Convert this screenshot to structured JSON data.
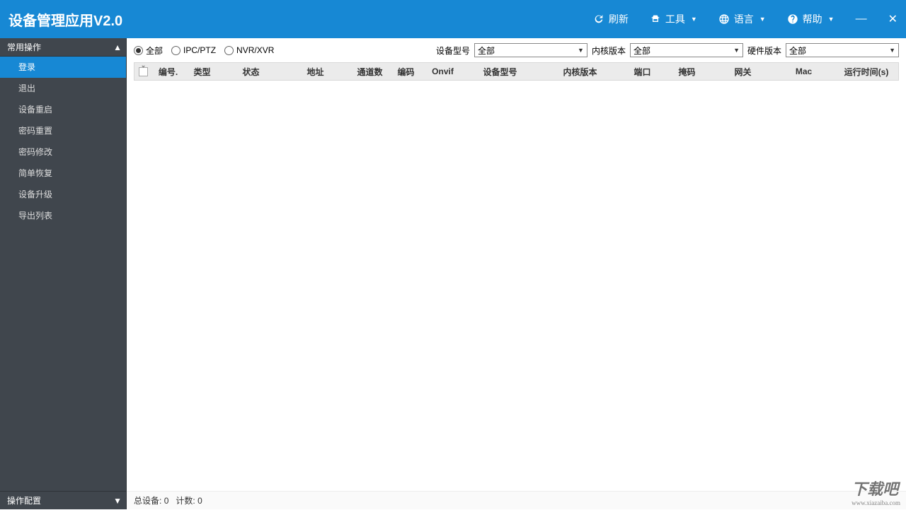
{
  "titlebar": {
    "title": "设备管理应用V2.0",
    "refresh": "刷新",
    "tools": "工具",
    "language": "语言",
    "help": "帮助"
  },
  "sidebar": {
    "header": "常用操作",
    "items": [
      {
        "label": "登录",
        "active": true
      },
      {
        "label": "退出",
        "active": false
      },
      {
        "label": "设备重启",
        "active": false
      },
      {
        "label": "密码重置",
        "active": false
      },
      {
        "label": "密码修改",
        "active": false
      },
      {
        "label": "简单恢复",
        "active": false
      },
      {
        "label": "设备升级",
        "active": false
      },
      {
        "label": "导出列表",
        "active": false
      }
    ],
    "footer": "操作配置"
  },
  "filters": {
    "radios": [
      {
        "label": "全部",
        "checked": true
      },
      {
        "label": "IPC/PTZ",
        "checked": false
      },
      {
        "label": "NVR/XVR",
        "checked": false
      }
    ],
    "device_type_label": "设备型号",
    "device_type_value": "全部",
    "kernel_label": "内核版本",
    "kernel_value": "全部",
    "hardware_label": "硬件版本",
    "hardware_value": "全部"
  },
  "table": {
    "columns": [
      "编号.",
      "类型",
      "状态",
      "地址",
      "通道数",
      "编码",
      "Onvif",
      "设备型号",
      "内核版本",
      "端口",
      "掩码",
      "网关",
      "Mac",
      "运行时间(s)"
    ]
  },
  "statusbar": {
    "total_label": "总设备:",
    "total_value": "0",
    "count_label": "计数:",
    "count_value": "0"
  },
  "watermark": {
    "text": "下载吧",
    "url": "www.xiazaiba.com"
  }
}
